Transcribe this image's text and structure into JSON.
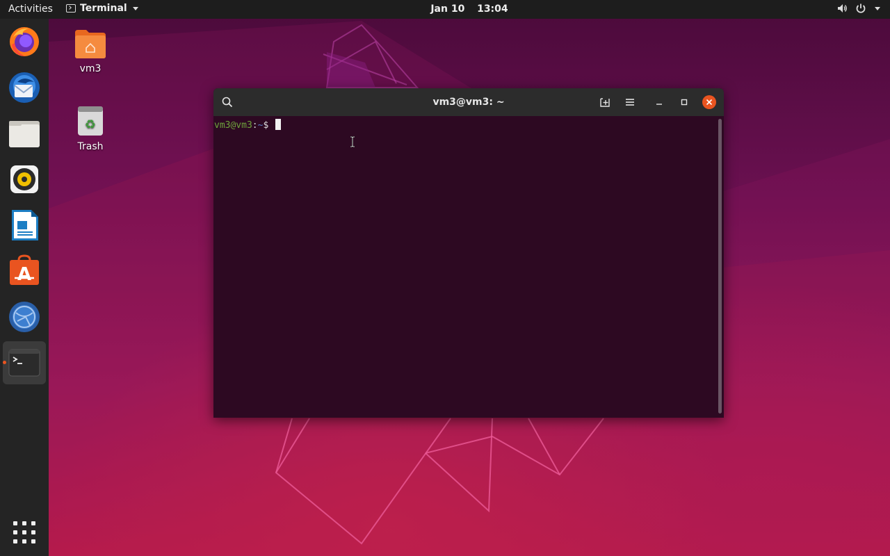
{
  "topbar": {
    "activities": "Activities",
    "app_menu_label": "Terminal",
    "app_menu_icon": "terminal-icon",
    "date": "Jan 10",
    "time": "13:04",
    "system_icons": [
      "volume-icon",
      "power-icon",
      "chevron-down-icon"
    ]
  },
  "dock": {
    "items": [
      {
        "name": "Firefox",
        "icon": "firefox-icon"
      },
      {
        "name": "Thunderbird",
        "icon": "thunderbird-icon"
      },
      {
        "name": "Files",
        "icon": "files-icon"
      },
      {
        "name": "Rhythmbox",
        "icon": "rhythmbox-icon"
      },
      {
        "name": "LibreOffice Writer",
        "icon": "writer-icon"
      },
      {
        "name": "Ubuntu Software",
        "icon": "software-icon"
      },
      {
        "name": "Help",
        "icon": "help-icon"
      },
      {
        "name": "Terminal",
        "icon": "terminal-icon",
        "running": true
      }
    ],
    "show_apps_icon": "grid-icon"
  },
  "desktop": {
    "icons": [
      {
        "label": "vm3",
        "icon": "home-folder-icon"
      },
      {
        "label": "Trash",
        "icon": "trash-icon"
      }
    ]
  },
  "terminal": {
    "title": "vm3@vm3: ~",
    "prompt": {
      "user_host": "vm3@vm3",
      "colon": ":",
      "path": "~",
      "dollar": "$ "
    },
    "buttons": [
      "search-icon",
      "new-tab-icon",
      "hamburger-menu-icon",
      "minimize-icon",
      "maximize-icon",
      "close-icon"
    ]
  },
  "colors": {
    "accent": "#e95420",
    "terminal_bg": "#2d0922",
    "prompt_user": "#6ea33c",
    "prompt_path": "#5a7fc8"
  }
}
